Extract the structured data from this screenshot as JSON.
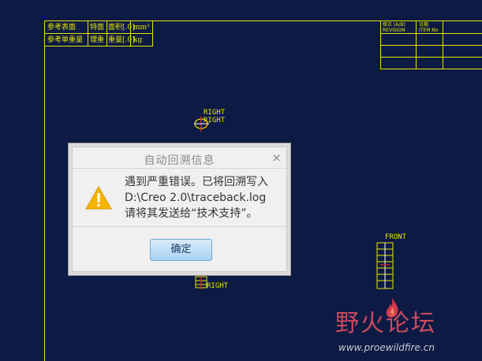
{
  "drawing": {
    "table_top_left": {
      "row1": {
        "label": "参考表面",
        "cell1": "特面",
        "cell2": "面积[.0]",
        "unit": "mm²"
      },
      "row2": {
        "label": "参考单重量",
        "cell1": "理重",
        "cell2": "重量[.0]",
        "unit": "kg"
      }
    },
    "table_top_right": {
      "header_a": "修正 (A/B)",
      "header_b": "REVISION",
      "header_c": "日期",
      "header_d": "ITEM No"
    },
    "view_labels": {
      "right_top_1": "RIGHT",
      "right_top_2": "RIGHT",
      "front": "FRONT",
      "right_bottom": "RIGHT"
    },
    "colors": {
      "background": "#0d1a44",
      "lines": "#e6e600",
      "accent_red": "#d22a2a"
    }
  },
  "dialog": {
    "title": "自动回溯信息",
    "close_symbol": "×",
    "message_line1": "遇到严重错误。已将回溯写入",
    "message_line2": "D:\\Creo 2.0\\traceback.log",
    "message_line3": "请将其发送给“技术支持”。",
    "ok_label": "确定",
    "icon": "warning-icon"
  },
  "watermark": {
    "brand": "野火论坛",
    "url": "www.proewildfire.cn"
  }
}
